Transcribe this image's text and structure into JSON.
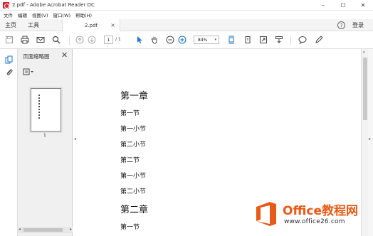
{
  "window": {
    "title": "2.pdf - Adobe Acrobat Reader DC",
    "controls": {
      "minimize": "–",
      "maximize": "☐",
      "close": "✕"
    }
  },
  "menubar": {
    "items": [
      "文件",
      "编辑",
      "视图(V)",
      "窗口(W)",
      "帮助(H)"
    ]
  },
  "tabbar": {
    "home": "主页",
    "tools": "工具",
    "doc_tab": "2.pdf",
    "close": "×",
    "help": "?",
    "login": "登录"
  },
  "toolbar": {
    "page_current": "1",
    "page_total": "/ 1",
    "zoom": "84%",
    "zoom_arrow": "▾"
  },
  "thumbnails": {
    "title": "页面缩略图",
    "close": "✕",
    "page_number": "1",
    "scroll_left": "◂",
    "scroll_right": "▸"
  },
  "document": {
    "lines": [
      {
        "text": "第一章",
        "level": "h1"
      },
      {
        "text": "第一节",
        "level": "h2"
      },
      {
        "text": "第一小节",
        "level": "h2"
      },
      {
        "text": "第二小节",
        "level": "h2"
      },
      {
        "text": "第二节",
        "level": "h2"
      },
      {
        "text": "第一小节",
        "level": "h2"
      },
      {
        "text": "第二小节",
        "level": "h2"
      },
      {
        "text": "第二章",
        "level": "h1"
      },
      {
        "text": "第一节",
        "level": "h2"
      }
    ]
  },
  "panel_toggles": {
    "left": "◂",
    "right": "▸",
    "scroll_up": "▴"
  },
  "watermark": {
    "brand": "Office教程网",
    "url": "www.office26.com"
  },
  "colors": {
    "accent_blue": "#1a73c8",
    "watermark_orange": "#e85a15",
    "adobe_red": "#d8232a"
  }
}
